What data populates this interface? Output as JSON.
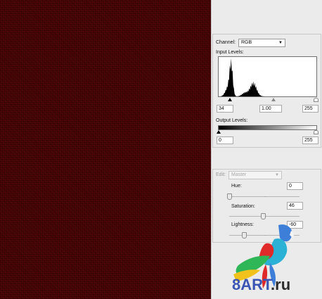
{
  "canvas": {
    "fill": "#4a0505"
  },
  "levels": {
    "channel_label": "Channel:",
    "channel_value": "RGB",
    "input_levels_label": "Input Levels:",
    "input_black": "34",
    "input_gamma": "1.00",
    "input_white": "255",
    "output_levels_label": "Output Levels:",
    "output_black": "0",
    "output_white": "255"
  },
  "hue_sat": {
    "edit_label": "Edit:",
    "edit_value": "Master",
    "hue_label": "Hue:",
    "hue_value": "0",
    "saturation_label": "Saturation:",
    "saturation_value": "46",
    "lightness_label": "Lightness:",
    "lightness_value": "-60"
  },
  "watermark": {
    "text_main": "8ART",
    "text_ext": ".ru"
  }
}
